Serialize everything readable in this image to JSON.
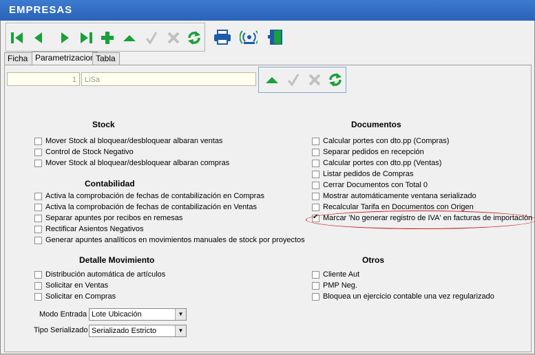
{
  "window": {
    "title": "EMPRESAS"
  },
  "toolbar": {
    "icons": [
      "first-icon",
      "prev-icon",
      "next-icon",
      "last-icon",
      "add-icon",
      "up-icon",
      "confirm-icon",
      "cancel-icon",
      "refresh-icon",
      "print-icon",
      "connect-icon",
      "exit-icon"
    ]
  },
  "tabs": [
    {
      "label": "Ficha",
      "active": false
    },
    {
      "label": "Parametrizacion",
      "active": true
    },
    {
      "label": "Tabla",
      "active": false
    }
  ],
  "fields": {
    "code": "1",
    "name": "LiSa"
  },
  "stock": {
    "title": "Stock",
    "items": [
      {
        "label": "Mover Stock al bloquear/desbloquear albaran ventas",
        "checked": false
      },
      {
        "label": "Control de Stock Negativo",
        "checked": false
      },
      {
        "label": "Mover Stock al bloquear/desbloquear albaran compras",
        "checked": false
      }
    ]
  },
  "contabilidad": {
    "title": "Contabilidad",
    "items": [
      {
        "label": "Activa la comprobación de fechas de contabilización en Compras",
        "checked": false
      },
      {
        "label": "Activa la comprobación de fechas de contabilización en Ventas",
        "checked": false
      },
      {
        "label": "Separar apuntes por recibos en remesas",
        "checked": false
      },
      {
        "label": "Rectificar Asientos Negativos",
        "checked": false
      },
      {
        "label": "Generar apuntes analíticos en movimientos manuales de stock por proyectos",
        "checked": false
      }
    ]
  },
  "detalle": {
    "title": "Detalle Movimiento",
    "items": [
      {
        "label": "Distribución automática de artículos",
        "checked": false
      },
      {
        "label": "Solicitar en Ventas",
        "checked": false
      },
      {
        "label": "Solicitar en Compras",
        "checked": false
      }
    ],
    "modo_entrada_label": "Modo Entrada",
    "modo_entrada_value": "Lote Ubicación",
    "tipo_serializado_label": "Tipo Serializado",
    "tipo_serializado_value": "Serializado Estricto"
  },
  "documentos": {
    "title": "Documentos",
    "items": [
      {
        "label": "Calcular portes con dto.pp (Compras)",
        "checked": false
      },
      {
        "label": "Separar pedidos en recepción",
        "checked": false
      },
      {
        "label": "Calcular portes con dto.pp (Ventas)",
        "checked": false
      },
      {
        "label": "Listar pedidos de Compras",
        "checked": false
      },
      {
        "label": "Cerrar Documentos con Total 0",
        "checked": false
      },
      {
        "label": "Mostrar automáticamente ventana serializado",
        "checked": false
      },
      {
        "label": "Recalcular Tarifa en Documentos con Origen",
        "checked": false
      },
      {
        "label": "Marcar 'No generar registro de IVA' en facturas de importación",
        "checked": true
      }
    ]
  },
  "otros": {
    "title": "Otros",
    "items": [
      {
        "label": "Cliente Aut",
        "checked": false
      },
      {
        "label": "PMP Neg.",
        "checked": false
      },
      {
        "label": "Bloquea un ejercicio contable una vez regularizado",
        "checked": false
      }
    ]
  },
  "colors": {
    "titlebar": "#2a62b8",
    "toolbar_green": "#1aa03a",
    "highlight_oval": "#d01818",
    "field_bg": "#fffff0"
  }
}
